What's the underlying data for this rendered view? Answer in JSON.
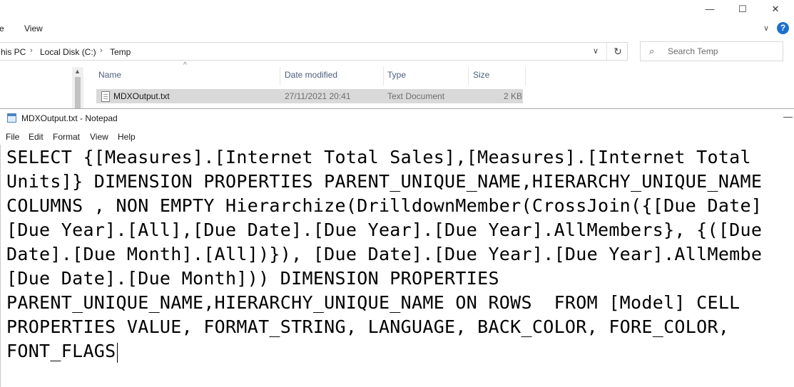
{
  "explorer": {
    "menu": [
      "e",
      "View"
    ],
    "window_controls": {
      "minimize": "—",
      "maximize": "☐",
      "close": "✕"
    },
    "breadcrumb": [
      "his PC",
      "Local Disk (C:)",
      "Temp"
    ],
    "search_placeholder": "Search Temp",
    "columns": [
      "Name",
      "Date modified",
      "Type",
      "Size"
    ],
    "files": [
      {
        "name": "MDXOutput.txt",
        "date_modified": "27/11/2021 20:41",
        "type": "Text Document",
        "size": "2 KB"
      }
    ]
  },
  "notepad": {
    "title": "MDXOutput.txt - Notepad",
    "menu": [
      "File",
      "Edit",
      "Format",
      "View",
      "Help"
    ],
    "content_lines": [
      "SELECT {[Measures].[Internet Total Sales],[Measures].[Internet Total",
      "Units]} DIMENSION PROPERTIES PARENT_UNIQUE_NAME,HIERARCHY_UNIQUE_NAME",
      "COLUMNS , NON EMPTY Hierarchize(DrilldownMember(CrossJoin({[Due Date]",
      "[Due Year].[All],[Due Date].[Due Year].[Due Year].AllMembers}, {([Due",
      "Date].[Due Month].[All])}), [Due Date].[Due Year].[Due Year].AllMembe",
      "[Due Date].[Due Month])) DIMENSION PROPERTIES",
      "PARENT_UNIQUE_NAME,HIERARCHY_UNIQUE_NAME ON ROWS  FROM [Model] CELL",
      "PROPERTIES VALUE, FORMAT_STRING, LANGUAGE, BACK_COLOR, FORE_COLOR,",
      "FONT_FLAGS"
    ]
  }
}
